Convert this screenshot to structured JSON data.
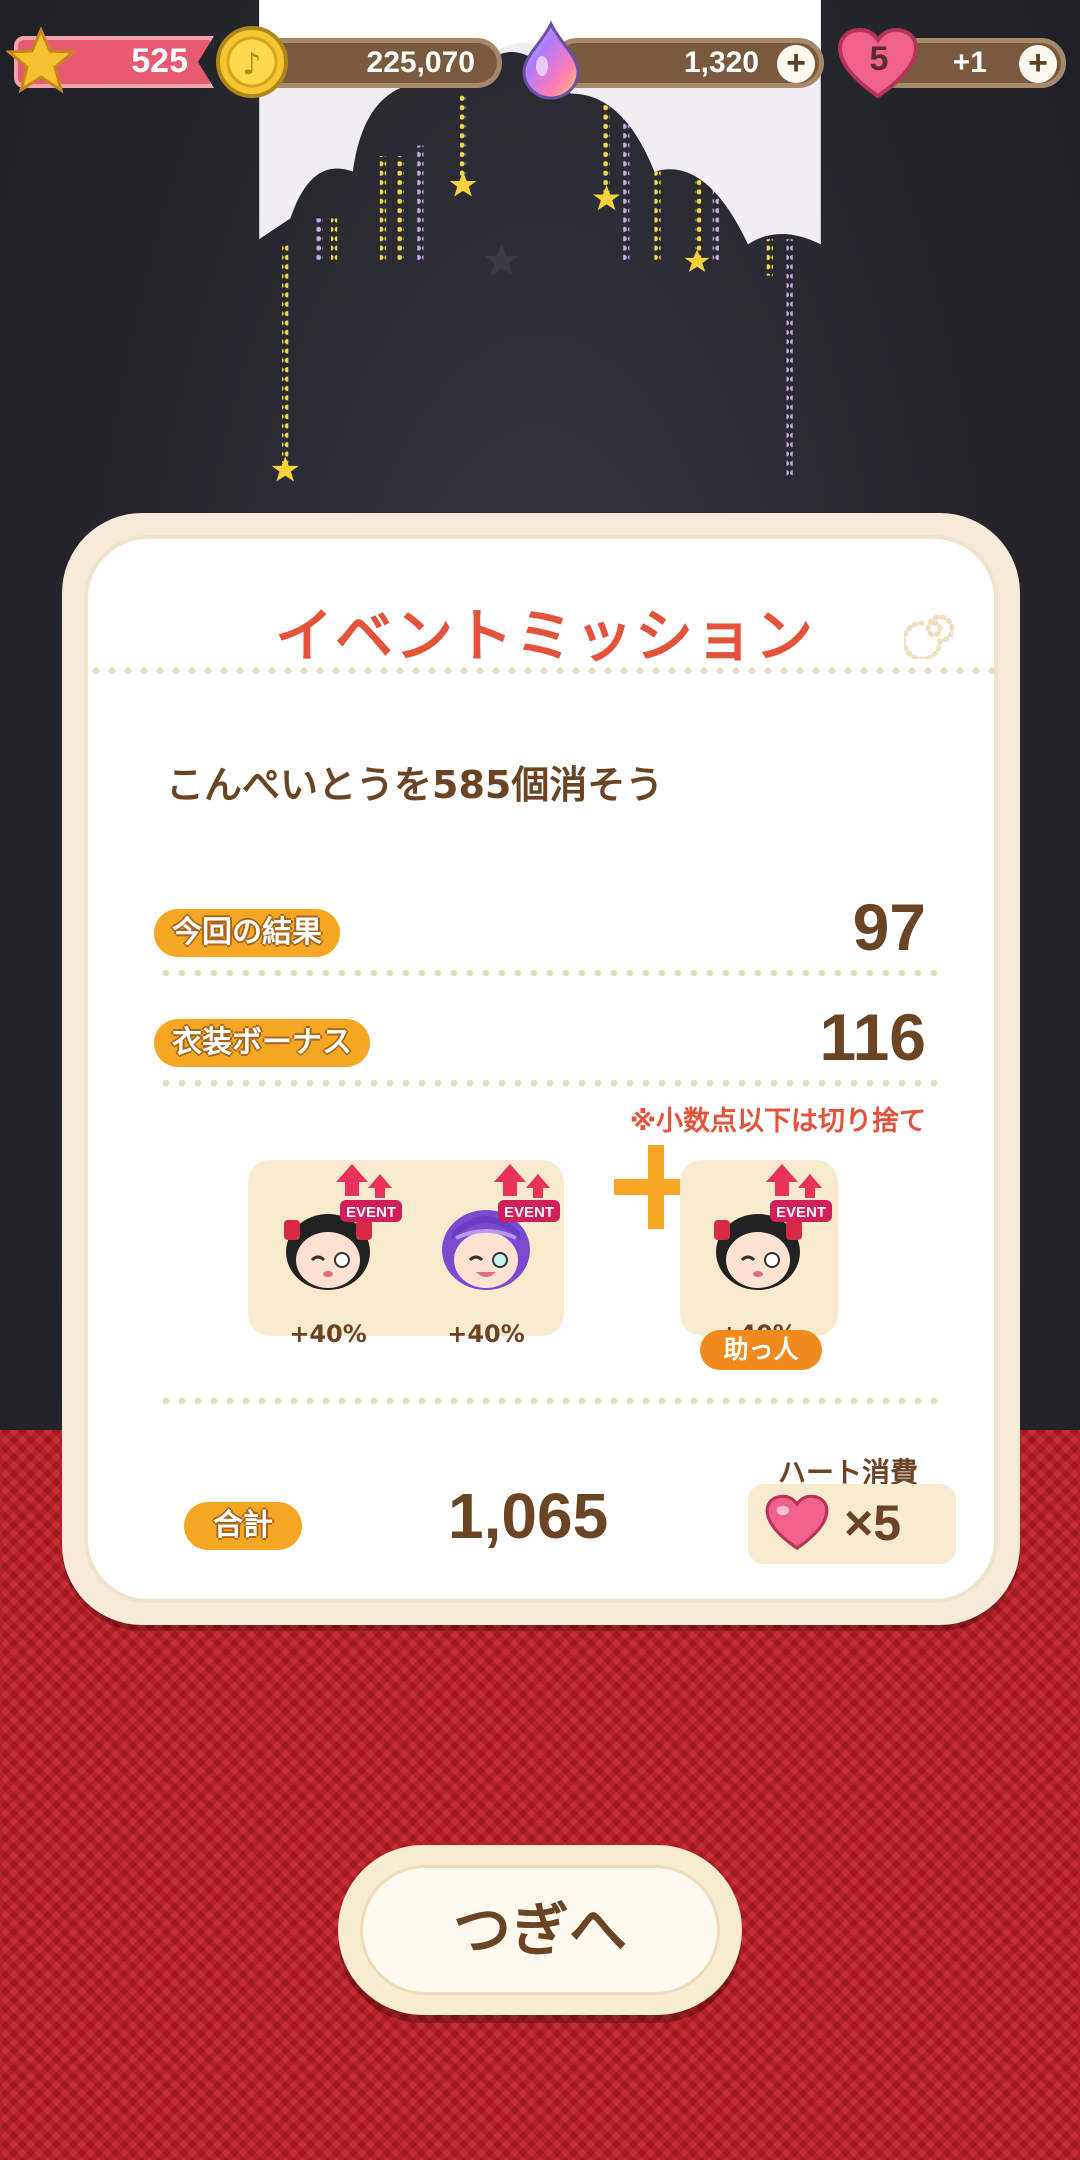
{
  "status_bar": {
    "rank": "525",
    "gold": "225,070",
    "gems": "1,320",
    "hearts": "5",
    "heart_recovery": "+1"
  },
  "panel": {
    "title": "イベントミッション",
    "mission": "こんぺいとうを585個消そう",
    "result_label": "今回の結果",
    "result_value": "97",
    "bonus_label": "衣装ボーナス",
    "bonus_value": "116",
    "rounding_note": "※小数点以下は切り捨て",
    "team": [
      {
        "bonus": "+40%",
        "badge": "EVENT",
        "character": "black-twintails"
      },
      {
        "bonus": "+40%",
        "badge": "EVENT",
        "character": "purple-braid"
      }
    ],
    "helper": {
      "bonus": "+40%",
      "badge": "EVENT",
      "character": "black-twintails",
      "label": "助っ人"
    },
    "total_label": "合計",
    "total_value": "1,065",
    "heart_cost_label": "ハート消費",
    "heart_cost_value": "×5"
  },
  "next_button": "つぎへ",
  "colors": {
    "title_red": "#e4523a",
    "brown_text": "#6b4424",
    "label_orange": "#f5a623",
    "carpet_red": "#c51f25"
  }
}
